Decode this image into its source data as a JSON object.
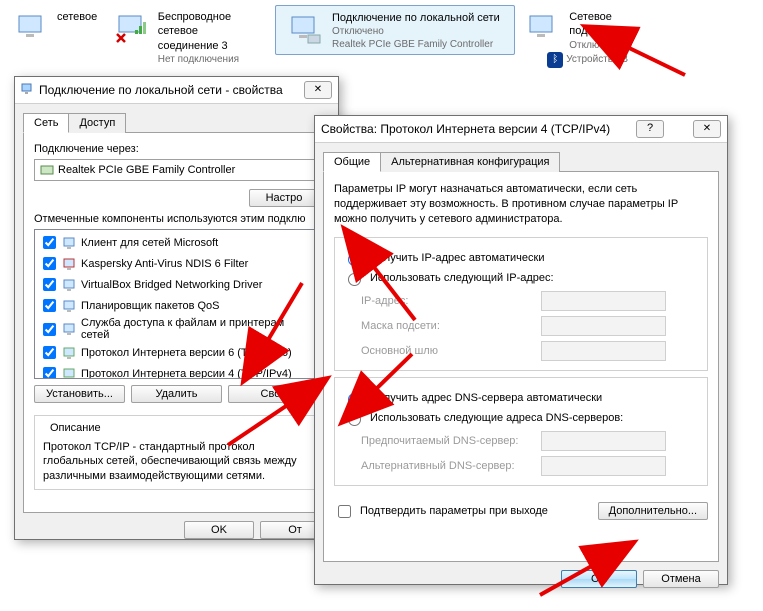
{
  "top": {
    "item1_line1": "сетевое",
    "item2_title": "Беспроводное сетевое",
    "item2_line2": "соединение 3",
    "item2_line3": "Нет подключения",
    "item3_title": "Подключение по локальной сети",
    "item3_line2": "Отключено",
    "item3_line3": "Realtek PCIe GBE Family Controller",
    "item4_title": "Сетевое подк",
    "item4_line2": "Отключено",
    "item4_line3": "Устройства B"
  },
  "dlg1": {
    "title": "Подключение по локальной сети - свойства",
    "tab_network": "Сеть",
    "tab_access": "Доступ",
    "connect_via": "Подключение через:",
    "adapter": "Realtek PCIe GBE Family Controller",
    "configure_btn": "Настро",
    "components_label": "Отмеченные компоненты используются этим подклю",
    "components": [
      "Клиент для сетей Microsoft",
      "Kaspersky Anti-Virus NDIS 6 Filter",
      "VirtualBox Bridged Networking Driver",
      "Планировщик пакетов QoS",
      "Служба доступа к файлам и принтерам сетей",
      "Протокол Интернета версии 6 (TCP/IPv6)",
      "Протокол Интернета версии 4 (TCP/IPv4)"
    ],
    "install_btn": "Установить...",
    "remove_btn": "Удалить",
    "props_btn": "Свой",
    "desc_title": "Описание",
    "desc_text": "Протокол TCP/IP - стандартный протокол глобальных сетей, обеспечивающий связь между различными взаимодействующими сетями.",
    "ok": "OK",
    "cancel": "От"
  },
  "dlg2": {
    "title": "Свойства: Протокол Интернета версии 4 (TCP/IPv4)",
    "tab_general": "Общие",
    "tab_alt": "Альтернативная конфигурация",
    "info_text": "Параметры IP могут назначаться автоматически, если сеть поддерживает эту возможность. В противном случае параметры IP можно получить у сетевого администратора.",
    "radio_auto_ip": "Получить IP-адрес автоматически",
    "radio_manual_ip": "Использовать следующий IP-адрес:",
    "ip_label": "IP-адрес:",
    "mask_label": "Маска подсети:",
    "gateway_label": "Основной шлю",
    "radio_auto_dns": "Получить адрес DNS-сервера автоматически",
    "radio_manual_dns": "Использовать следующие адреса DNS-серверов:",
    "dns1_label": "Предпочитаемый DNS-сервер:",
    "dns2_label": "Альтернативный DNS-сервер:",
    "validate_check": "Подтвердить параметры при выходе",
    "advanced_btn": "Дополнительно...",
    "ok": "OK",
    "cancel": "Отмена"
  }
}
